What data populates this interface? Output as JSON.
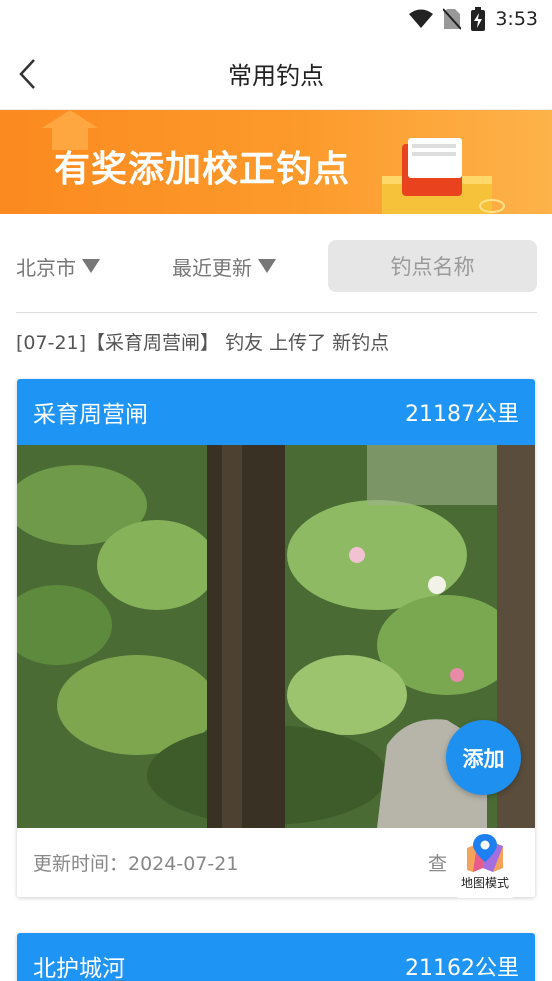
{
  "status_bar": {
    "time": "3:53"
  },
  "nav": {
    "title": "常用钓点",
    "back_icon": "chevron-left-icon"
  },
  "banner": {
    "text": "有奖添加校正钓点"
  },
  "filters": {
    "city": "北京市",
    "sort": "最近更新",
    "search_placeholder": "钓点名称"
  },
  "notice": "[07-21]【采育周营闸】 钓友 上传了 新钓点",
  "spots": [
    {
      "name": "采育周营闸",
      "distance": "21187公里",
      "updated": "更新时间：2024-07-21",
      "view": "查"
    },
    {
      "name": "北护城河",
      "distance": "21162公里"
    }
  ],
  "actions": {
    "add": "添加",
    "map_mode": "地图模式"
  },
  "colors": {
    "accent_blue": "#1e94f5",
    "banner_orange": "#fb8a1f"
  }
}
